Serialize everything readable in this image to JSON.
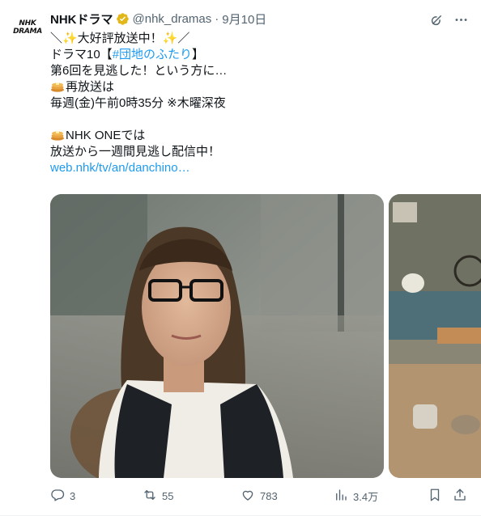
{
  "tweet": {
    "author_name": "NHKドラマ",
    "handle": "@nhk_dramas",
    "separator": "·",
    "date": "9月10日",
    "avatar": {
      "line1": "NHK",
      "line2": "DRAMA"
    },
    "lines": {
      "l1": "＼✨大好評放送中！✨／",
      "l2_prefix": "ドラマ10【",
      "l2_hashtag": "#団地のふたり",
      "l2_suffix": "】",
      "l3": "第6回を見逃した！という方に…",
      "l4": "再放送は",
      "l5": "毎週(金)午前0時35分 ※木曜深夜",
      "l6": "NHK ONEでは",
      "l7": "放送から一週間見逃し配信中！",
      "link": "web.nhk/tv/an/danchino…"
    },
    "icons": {
      "verified": "verified-badge-icon",
      "grok": "grok-icon",
      "more": "more-icon",
      "pancake": "pancake-emoji"
    }
  },
  "actions": {
    "reply": {
      "icon": "reply-icon",
      "count": "3"
    },
    "retweet": {
      "icon": "retweet-icon",
      "count": "55"
    },
    "like": {
      "icon": "like-icon",
      "count": "783"
    },
    "views": {
      "icon": "views-icon",
      "count": "3.4万"
    },
    "bookmark": {
      "icon": "bookmark-icon"
    },
    "share": {
      "icon": "share-icon"
    }
  },
  "colors": {
    "text": "#0f1419",
    "secondary": "#536471",
    "link": "#1d9bf0",
    "verified": "#e2b719"
  }
}
